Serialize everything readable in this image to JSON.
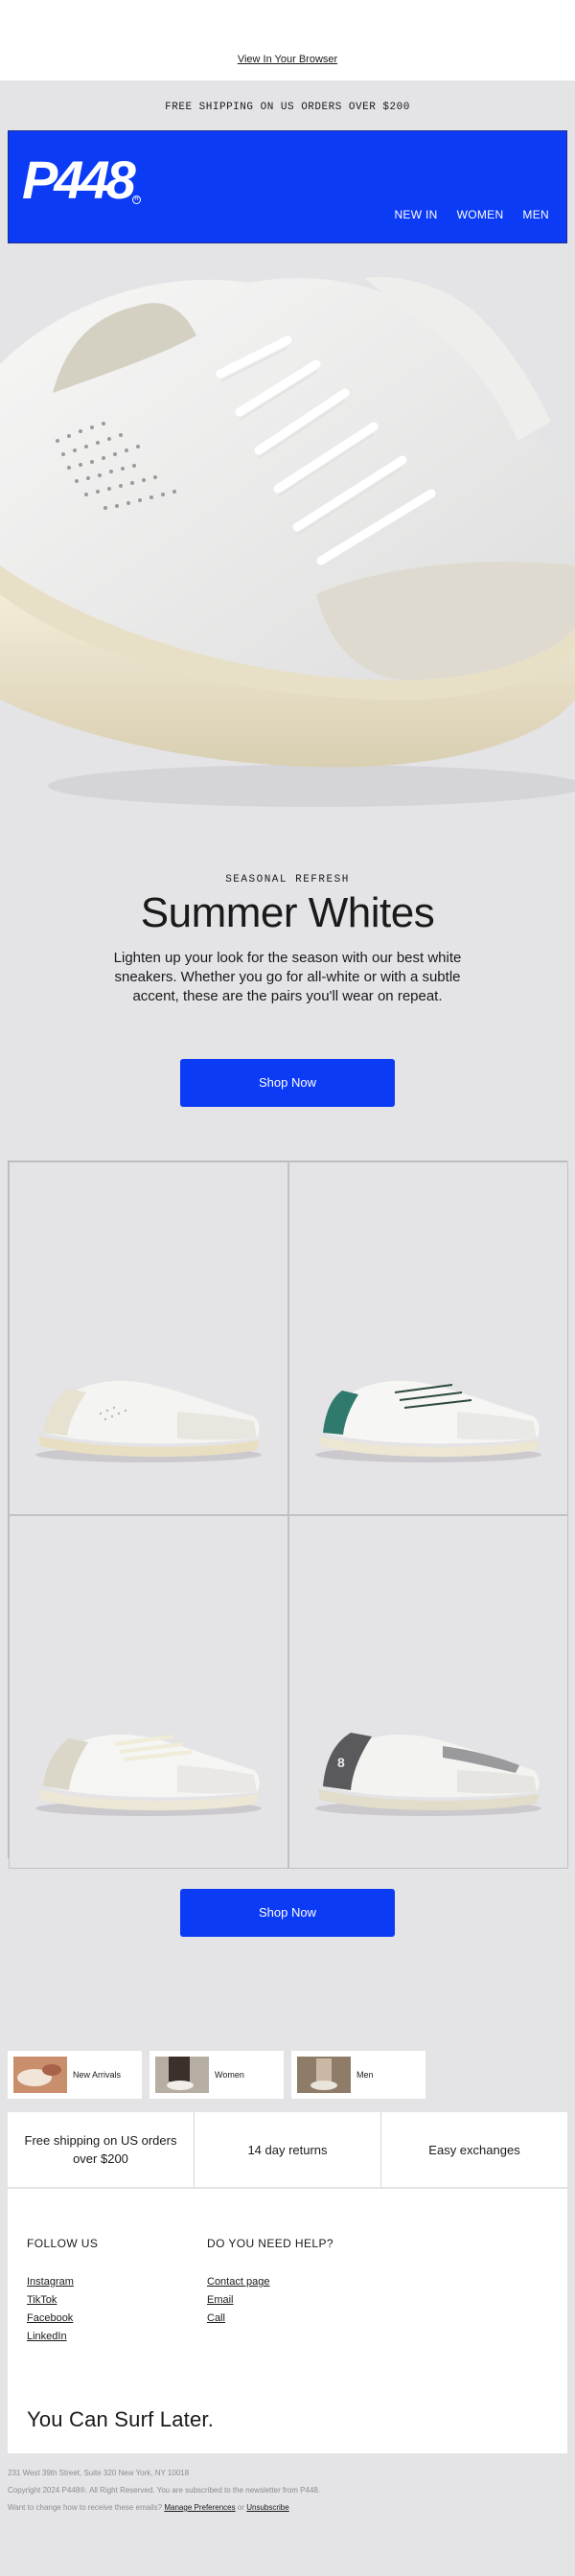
{
  "preheader": {
    "browser_link": "View In Your Browser"
  },
  "shipping_bar": {
    "text": "FREE SHIPPING ON US ORDERS OVER $200"
  },
  "header": {
    "logo": "P448",
    "nav": [
      "NEW IN",
      "WOMEN",
      "MEN"
    ],
    "brand_color": "#0c3bf6"
  },
  "hero": {
    "eyebrow": "SEASONAL REFRESH",
    "title": "Summer Whites",
    "body": "Lighten up your look for the season with our best white sneakers. Whether you go for all-white or with a subtle accent, these are the pairs you'll wear on repeat.",
    "cta": "Shop Now"
  },
  "products": [
    {
      "name": "white-sneaker-cream",
      "accent": "#e6e1d0"
    },
    {
      "name": "white-sneaker-green",
      "accent": "#2f7a6c"
    },
    {
      "name": "white-sneaker-ivory",
      "accent": "#dad7c8"
    },
    {
      "name": "white-sneaker-grey",
      "accent": "#5a5a5c"
    }
  ],
  "secondary_cta": "Shop Now",
  "categories": [
    {
      "label": "New Arrivals"
    },
    {
      "label": "Women"
    },
    {
      "label": "Men"
    }
  ],
  "perks": [
    "Free shipping on US orders over $200",
    "14 day returns",
    "Easy exchanges"
  ],
  "follow": {
    "title": "FOLLOW US",
    "links": [
      "Instagram",
      "TikTok",
      "Facebook",
      "LinkedIn"
    ]
  },
  "help": {
    "title": "DO YOU NEED HELP?",
    "links": [
      "Contact page",
      "Email",
      "Call"
    ]
  },
  "tagline": "You Can Surf Later.",
  "footer": {
    "address": "231 West 39th Street, Suite 320 New York, NY 10018",
    "copyright": "Copyright 2024 P448®. All Right Reserved. You are subscribed to the newsletter from P448.",
    "prefs_prefix": "Want to change how to receive these emails?",
    "manage": "Manage Preferences",
    "or": "or",
    "unsubscribe": "Unsubscribe"
  }
}
